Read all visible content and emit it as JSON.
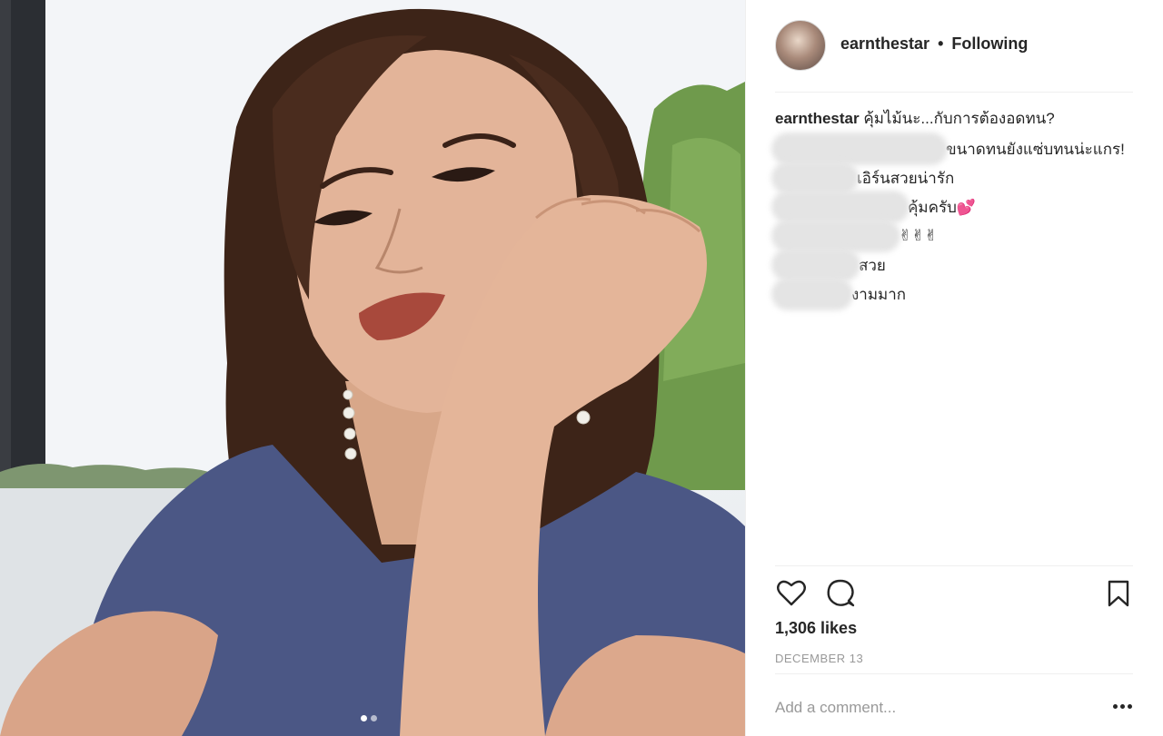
{
  "post": {
    "username": "earnthestar",
    "separator": "•",
    "follow_status": "Following",
    "caption_user": "earnthestar",
    "caption_text": "คุ้มไม้นะ...กับการต้องอดทน?"
  },
  "comments": [
    {
      "text": "ขนาดทนยังแซ่บทนน่ะแกร!"
    },
    {
      "text": "เอิร์นสวยน่ารัก"
    },
    {
      "text": "คุ้มครับ💕"
    },
    {
      "text": "✌✌✌"
    },
    {
      "text": "สวย"
    },
    {
      "text": "งามมาก"
    }
  ],
  "stats": {
    "likes": "1,306 likes",
    "date": "DECEMBER 13"
  },
  "comment_box": {
    "placeholder": "Add a comment..."
  },
  "icons": {
    "like": "heart-icon",
    "comment": "comment-bubble-icon",
    "save": "bookmark-icon",
    "more": "more-options-icon"
  },
  "carousel": {
    "count": 2,
    "active_index": 0
  }
}
